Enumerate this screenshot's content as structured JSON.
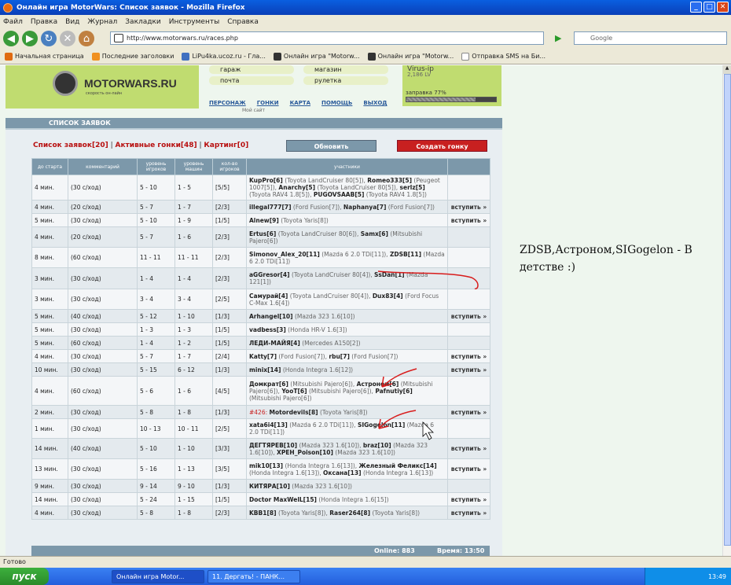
{
  "window": {
    "title": "Онлайн игра MotorWars: Список заявок - Mozilla Firefox",
    "controls": [
      "_",
      "□",
      "✕"
    ]
  },
  "menu": [
    "Файл",
    "Правка",
    "Вид",
    "Журнал",
    "Закладки",
    "Инструменты",
    "Справка"
  ],
  "nav": {
    "url": "http://www.motorwars.ru/races.php",
    "search_placeholder": "Google"
  },
  "bookmarks": [
    "Начальная страница",
    "Последние заголовки",
    "LiPu4ka.ucoz.ru - Гла...",
    "Онлайн игра \"Motorw...",
    "Онлайн игра \"Motorw...",
    "Отправка SMS на Би..."
  ],
  "site": {
    "logo": "MOTORWARS.RU",
    "logo_sub": "скорость он-лайн",
    "menu": [
      "гараж",
      "магазин",
      "почта",
      "рулетка"
    ],
    "topnav": [
      "ПЕРСОНАЖ",
      "ГОНКИ",
      "КАРТА",
      "ПОМОЩЬ",
      "ВЫХОД"
    ],
    "mysite": "Мой сайт",
    "user": {
      "name": "Virus-ip",
      "money": "2,186 LV",
      "fuel_label": "заправка 77%",
      "fuel": 0.77
    }
  },
  "panel": {
    "title": "СПИСОК ЗАЯВОК",
    "tab1": "Список заявок[20]",
    "tab2": "Активные гонки[48]",
    "tab3": "Картинг[0]",
    "btn_update": "Обновить",
    "btn_create": "Создать гонку",
    "cols": [
      "до старта",
      "комментарий",
      "уровень игроков",
      "уровень машин",
      "кол-во игроков",
      "участники",
      ""
    ],
    "rows": [
      [
        "4 мин.",
        "(30 с/ход)",
        "5 - 10",
        "1 - 5",
        "[5/5]",
        "<b>KupPro[6]</b> <span class=tr>(Toyota LandCruiser 80[5]),</span> <b>Romeo333[5]</b> <span class=tr>(Peugeot 1007[5]),</span> <b>Anarchy[5]</b> <span class=tr>(Toyota LandCruiser 80[5]),</span> <b>serlz[5]</b> <span class=tr>(Toyota RAV4 1.8[5]),</span> <b>PUGOVSAAB[5]</b> <span class=tr>(Toyota RAV4 1.8[5])</span>",
        ""
      ],
      [
        "4 мин.",
        "(20 с/ход)",
        "5 - 7",
        "1 - 7",
        "[2/3]",
        "<b>illegal777[7]</b> <span class=tr>(Ford Fusion[7]),</span> <b>Naphanya[7]</b> <span class=tr>(Ford Fusion[7])</span>",
        "вступить »"
      ],
      [
        "5 мин.",
        "(30 с/ход)",
        "5 - 10",
        "1 - 9",
        "[1/5]",
        "<b>Alnew[9]</b> <span class=tr>(Toyota Yaris[8])</span>",
        "вступить »"
      ],
      [
        "4 мин.",
        "(20 с/ход)",
        "5 - 7",
        "1 - 6",
        "[2/3]",
        "<b>Ertus[6]</b> <span class=tr>(Toyota LandCruiser 80[6]),</span> <b>Samx[6]</b> <span class=tr>(Mitsubishi Pajero[6])</span>",
        ""
      ],
      [
        "8 мин.",
        "(60 с/ход)",
        "11 - 11",
        "11 - 11",
        "[2/3]",
        "<b>Simonov_Alex_20[11]</b> <span class=tr>(Mazda 6 2.0 TDi[11]),</span> <b>ZDSB[11]</b> <span class=tr>(Mazda 6 2.0 TDi[11])</span>",
        ""
      ],
      [
        "3 мин.",
        "(30 с/ход)",
        "1 - 4",
        "1 - 4",
        "[2/3]",
        "<b>aGGresor[4]</b> <span class=tr>(Toyota LandCruiser 80[4]),</span> <b>SsDan[1]</b> <span class=tr>(Mazda 121[1])</span>",
        ""
      ],
      [
        "3 мин.",
        "(30 с/ход)",
        "3 - 4",
        "3 - 4",
        "[2/5]",
        "<b>Самурай[4]</b> <span class=tr>(Toyota LandCruiser 80[4]),</span> <b>Dux83[4]</b> <span class=tr>(Ford Focus C-Max 1.6[4])</span>",
        ""
      ],
      [
        "5 мин.",
        "(40 с/ход)",
        "5 - 12",
        "1 - 10",
        "[1/3]",
        "<b>Arhangel[10]</b> <span class=tr>(Mazda 323 1.6[10])</span>",
        "вступить »"
      ],
      [
        "5 мин.",
        "(30 с/ход)",
        "1 - 3",
        "1 - 3",
        "[1/5]",
        "<b>vadbess[3]</b> <span class=tr>(Honda HR-V 1.6[3])</span>",
        ""
      ],
      [
        "5 мин.",
        "(60 с/ход)",
        "1 - 4",
        "1 - 2",
        "[1/5]",
        "<b>ЛЕДИ-МАЙЯ[4]</b> <span class=tr>(Mercedes A150[2])</span>",
        ""
      ],
      [
        "4 мин.",
        "(30 с/ход)",
        "5 - 7",
        "1 - 7",
        "[2/4]",
        "<b>Katty[7]</b> <span class=tr>(Ford Fusion[7]),</span> <b>rbu[7]</b> <span class=tr>(Ford Fusion[7])</span>",
        "вступить »"
      ],
      [
        "10 мин.",
        "(30 с/ход)",
        "5 - 15",
        "6 - 12",
        "[1/3]",
        "<b>minix[14]</b> <span class=tr>(Honda Integra 1.6[12])</span>",
        "вступить »"
      ],
      [
        "4 мин.",
        "(60 с/ход)",
        "5 - 6",
        "1 - 6",
        "[4/5]",
        "<b>Домкрат[6]</b> <span class=tr>(Mitsubishi Pajero[6]),</span> <b>Астроном[6]</b> <span class=tr>(Mitsubishi Pajero[6]),</span> <b>YooT[6]</b> <span class=tr>(Mitsubishi Pajero[6]),</span> <b>Pafnutiy[6]</b> <span class=tr>(Mitsubishi Pajero[6])</span>",
        ""
      ],
      [
        "2 мин.",
        "(30 с/ход)",
        "5 - 8",
        "1 - 8",
        "[1/3]",
        "<span class=hot>#426:</span> <b>Motordevils[8]</b> <span class=tr>(Toyota Yaris[8])</span>",
        "вступить »"
      ],
      [
        "1 мин.",
        "(30 с/ход)",
        "10 - 13",
        "10 - 11",
        "[2/5]",
        "<b>xata6i4[13]</b> <span class=tr>(Mazda 6 2.0 TDi[11]),</span> <b>SIGogelon[11]</b> <span class=tr>(Mazda 6 2.0 TDi[11])</span>",
        ""
      ],
      [
        "14 мин.",
        "(40 с/ход)",
        "5 - 10",
        "1 - 10",
        "[3/3]",
        "<b>ДЕГТЯРЕВ[10]</b> <span class=tr>(Mazda 323 1.6[10]),</span> <b>braz[10]</b> <span class=tr>(Mazda 323 1.6[10]),</span> <b>ХРЕН_Poison[10]</b> <span class=tr>(Mazda 323 1.6[10])</span>",
        "вступить »"
      ],
      [
        "13 мин.",
        "(30 с/ход)",
        "5 - 16",
        "1 - 13",
        "[3/5]",
        "<b>mik10[13]</b> <span class=tr>(Honda Integra 1.6[13]),</span> <b>Железный Феликс[14]</b> <span class=tr>(Honda Integra 1.6[13]),</span> <b>Оксана[13]</b> <span class=tr>(Honda Integra 1.6[13])</span>",
        "вступить »"
      ],
      [
        "9 мин.",
        "(30 с/ход)",
        "9 - 14",
        "9 - 10",
        "[1/3]",
        "<b>КИТЯРА[10]</b> <span class=tr>(Mazda 323 1.6[10])</span>",
        ""
      ],
      [
        "14 мин.",
        "(30 с/ход)",
        "5 - 24",
        "1 - 15",
        "[1/5]",
        "<b>Doctor MaxWelL[15]</b> <span class=tr>(Honda Integra 1.6[15])</span>",
        "вступить »"
      ],
      [
        "4 мин.",
        "(30 с/ход)",
        "5 - 8",
        "1 - 8",
        "[2/3]",
        "<b>KBB1[8]</b> <span class=tr>(Toyota Yaris[8]),</span> <b>Raser264[8]</b> <span class=tr>(Toyota Yaris[8])</span>",
        "вступить »"
      ]
    ],
    "online": "Online: 883",
    "time": "Время: 13:50"
  },
  "note": "ZDSB,Астроном,SIGogelon - В детстве :)",
  "status": "Готово",
  "taskbar": {
    "start": "пуск",
    "tasks": [
      "Онлайн игра Motor...",
      "11. Дергать! - ПАНК..."
    ],
    "clock": "13:49"
  }
}
